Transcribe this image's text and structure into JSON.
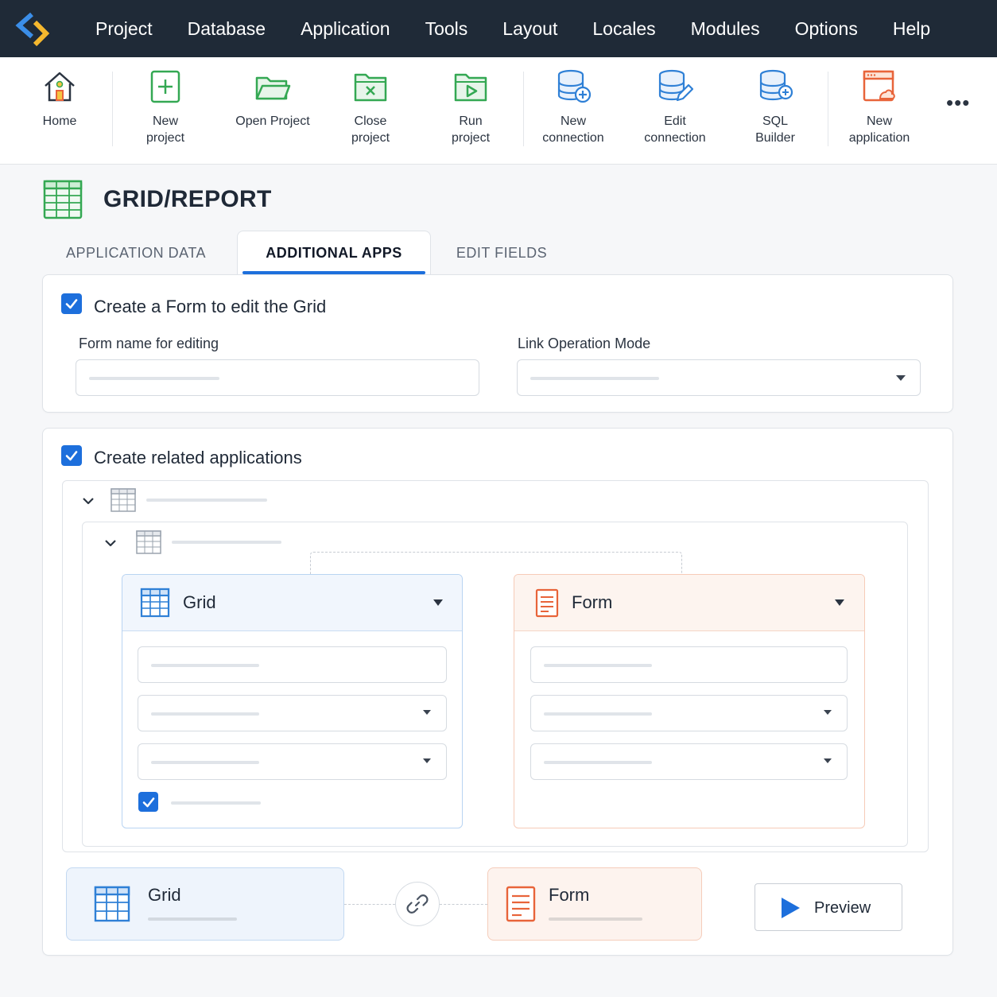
{
  "menubar": {
    "items": [
      "Project",
      "Database",
      "Application",
      "Tools",
      "Layout",
      "Locales",
      "Modules",
      "Options",
      "Help"
    ]
  },
  "toolbar": {
    "home": "Home",
    "new_project_1": "New",
    "new_project_2": "project",
    "open_project": "Open Project",
    "close_project_1": "Close",
    "close_project_2": "project",
    "run_project_1": "Run",
    "run_project_2": "project",
    "new_connection_1": "New",
    "new_connection_2": "connection",
    "edit_connection_1": "Edit",
    "edit_connection_2": "connection",
    "sql_builder_1": "SQL",
    "sql_builder_2": "Builder",
    "new_application_1": "New",
    "new_application_2": "application",
    "more": "•••"
  },
  "header": {
    "title": "GRID/REPORT"
  },
  "tabs": {
    "application_data": "APPLICATION DATA",
    "additional_apps": "ADDITIONAL APPS",
    "edit_fields": "EDIT FIELDS"
  },
  "form_section": {
    "checkbox_label": "Create a Form to edit the Grid",
    "form_name_label": "Form name for editing",
    "link_mode_label": "Link Operation Mode"
  },
  "related_section": {
    "checkbox_label": "Create related applications",
    "grid_card_title": "Grid",
    "form_card_title": "Form"
  },
  "summary": {
    "grid_title": "Grid",
    "form_title": "Form",
    "preview_label": "Preview"
  },
  "colors": {
    "menubar_bg": "#1f2a37",
    "accent_blue": "#1d6fdc",
    "icon_green": "#34a853",
    "icon_blue": "#2f80d6",
    "icon_orange": "#e8643a"
  }
}
